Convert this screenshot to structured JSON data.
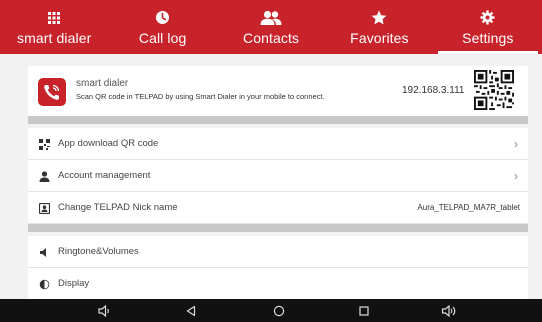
{
  "tabs": [
    {
      "label": "smart dialer",
      "icon": "dialpad-icon",
      "active": false
    },
    {
      "label": "Call log",
      "icon": "clock-icon",
      "active": false
    },
    {
      "label": "Contacts",
      "icon": "contacts-icon",
      "active": false
    },
    {
      "label": "Favorites",
      "icon": "star-icon",
      "active": false
    },
    {
      "label": "Settings",
      "icon": "gear-icon",
      "active": true
    }
  ],
  "dialer": {
    "title": "smart dialer",
    "description": "Scan QR code in TELPAD by using Smart Dialer in your mobile to connect.",
    "ip": "192.168.3.111"
  },
  "settings": {
    "app_download": "App download QR code",
    "account": "Account management",
    "nickname_label": "Change TELPAD Nick name",
    "nickname_value": "Aura_TELPAD_MA7R_tablet",
    "ringtone": "Ringtone&Volumes",
    "display": "Display"
  },
  "colors": {
    "accent": "#c8222b",
    "navbar": "#111111",
    "background": "#f2f2f2"
  }
}
